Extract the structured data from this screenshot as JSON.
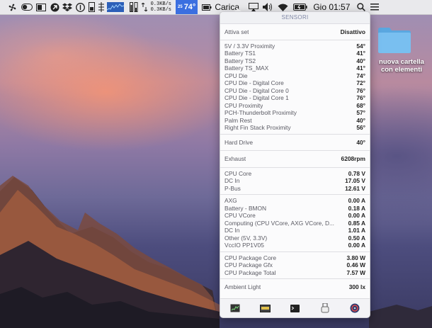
{
  "menubar": {
    "net_up": "0.3KB/s",
    "net_down": "0.3KB/s",
    "temperature_small": "25",
    "temperature": "74°",
    "battery_label": "Carica",
    "clock": "Gio 01:57",
    "icons": [
      "fan-icon",
      "toggle-icon",
      "display-icon",
      "circle-arrow-icon",
      "dropbox-icon",
      "info-icon",
      "cpu-meter-icon",
      "memory-icon",
      "activity-graph-icon",
      "disk-icon",
      "netspeed-icon",
      "airplay-icon",
      "volume-icon",
      "wifi-icon",
      "battery-icon",
      "search-icon",
      "list-icon"
    ]
  },
  "panel": {
    "title": "SENSORI",
    "toggle": {
      "label": "Attiva set",
      "value": "Disattivo"
    },
    "temperatures": [
      {
        "name": "5V / 3.3V Proximity",
        "value": "54°"
      },
      {
        "name": "Battery TS1",
        "value": "41°"
      },
      {
        "name": "Battery TS2",
        "value": "40°"
      },
      {
        "name": "Battery TS_MAX",
        "value": "41°"
      },
      {
        "name": "CPU Die",
        "value": "74°"
      },
      {
        "name": "CPU Die - Digital Core",
        "value": "72°"
      },
      {
        "name": "CPU Die - Digital Core 0",
        "value": "76°"
      },
      {
        "name": "CPU Die - Digital Core 1",
        "value": "76°"
      },
      {
        "name": "CPU Proximity",
        "value": "68°"
      },
      {
        "name": "PCH-Thunderbolt Proximity",
        "value": "57°"
      },
      {
        "name": "Palm Rest",
        "value": "40°"
      },
      {
        "name": "Right Fin Stack Proximity",
        "value": "56°"
      }
    ],
    "drive": [
      {
        "name": "Hard Drive",
        "value": "40°"
      }
    ],
    "fans": [
      {
        "name": "Exhaust",
        "value": "6208rpm"
      }
    ],
    "voltages": [
      {
        "name": "CPU Core",
        "value": "0.78 V"
      },
      {
        "name": "DC In",
        "value": "17.05 V"
      },
      {
        "name": "P-Bus",
        "value": "12.61 V"
      }
    ],
    "currents": [
      {
        "name": "AXG",
        "value": "0.00 A"
      },
      {
        "name": "Battery - BMON",
        "value": "0.18 A"
      },
      {
        "name": "CPU VCore",
        "value": "0.00 A"
      },
      {
        "name": "Computing (CPU VCore, AXG VCore, D...",
        "value": "0.85 A"
      },
      {
        "name": "DC In",
        "value": "1.01 A"
      },
      {
        "name": "Other (5V, 3.3V)",
        "value": "0.50 A"
      },
      {
        "name": "VccIO PP1V05",
        "value": "0.00 A"
      }
    ],
    "power": [
      {
        "name": "CPU Package Core",
        "value": "3.80 W"
      },
      {
        "name": "CPU Package Gfx",
        "value": "0.46 W"
      },
      {
        "name": "CPU Package Total",
        "value": "7.57 W"
      }
    ],
    "light": [
      {
        "name": "Ambient Light",
        "value": "300 lx"
      }
    ],
    "footer_icons": [
      "cpu-graph-icon",
      "memory-chip-icon",
      "terminal-icon",
      "usb-device-icon",
      "disk-utility-icon"
    ]
  },
  "desktop": {
    "folder_label": "nuova cartella con elementi"
  }
}
